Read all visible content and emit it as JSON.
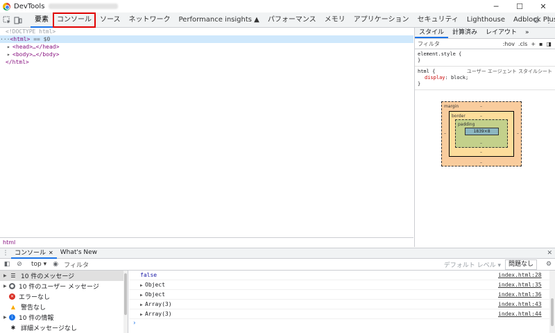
{
  "window": {
    "title": "DevTools",
    "controls": [
      "─",
      "☐",
      "✕"
    ]
  },
  "main_tabs": [
    {
      "label": "要素",
      "active": true
    },
    {
      "label": "コンソール",
      "highlighted": true
    },
    {
      "label": "ソース"
    },
    {
      "label": "ネットワーク"
    },
    {
      "label": "Performance insights ▲"
    },
    {
      "label": "パフォーマンス"
    },
    {
      "label": "メモリ"
    },
    {
      "label": "アプリケーション"
    },
    {
      "label": "セキュリティ"
    },
    {
      "label": "Lighthouse"
    },
    {
      "label": "Adblock Plus"
    }
  ],
  "elements": {
    "doctype": "<!DOCTYPE html>",
    "html_open": "<html>",
    "selected_marker": "== $0",
    "head": "<head>…</head>",
    "body": "<body>…</body>",
    "html_close": "</html>",
    "breadcrumb": "html"
  },
  "styles": {
    "tabs": [
      "スタイル",
      "計算済み",
      "レイアウト",
      "»"
    ],
    "filter_placeholder": "フィルタ",
    "hov": ":hov",
    "cls": ".cls",
    "element_style": "element.style {",
    "close_brace": "}",
    "rule_selector": "html {",
    "rule_source": "ユーザー エージェント スタイルシート",
    "prop_name": "display",
    "prop_value": "block;",
    "box_model": {
      "margin_label": "margin",
      "border_label": "border",
      "padding_label": "padding",
      "content": "1839×8",
      "dash": "–"
    }
  },
  "drawer": {
    "tabs": [
      {
        "label": "コンソール",
        "active": true
      },
      {
        "label": "What's New"
      }
    ],
    "context": "top ▾",
    "filter_placeholder": "フィルタ",
    "level": "デフォルト レベル ▾",
    "issues": "問題なし"
  },
  "sidebar": {
    "items": [
      {
        "label": "10 件のメッセージ",
        "icon": "list-icon",
        "selected": true
      },
      {
        "label": "10 件のユーザー メッセージ",
        "icon": "user-icon"
      },
      {
        "label": "エラーなし",
        "icon": "error-icon",
        "color": "#d93025"
      },
      {
        "label": "警告なし",
        "icon": "warning-icon",
        "color": "#f9ab00"
      },
      {
        "label": "10 件の情報",
        "icon": "info-icon",
        "color": "#1a73e8"
      },
      {
        "label": "詳細メッセージなし",
        "icon": "bug-icon"
      }
    ]
  },
  "console_log": [
    {
      "text": "false",
      "kind": "value",
      "source": "index.html:28"
    },
    {
      "text": "Object",
      "kind": "object",
      "source": "index.html:35"
    },
    {
      "text": "Object",
      "kind": "object",
      "source": "index.html:36"
    },
    {
      "text": "Array(3)",
      "kind": "object",
      "source": "index.html:43"
    },
    {
      "text": "Array(3)",
      "kind": "object",
      "source": "index.html:44"
    }
  ],
  "prompt": "›"
}
